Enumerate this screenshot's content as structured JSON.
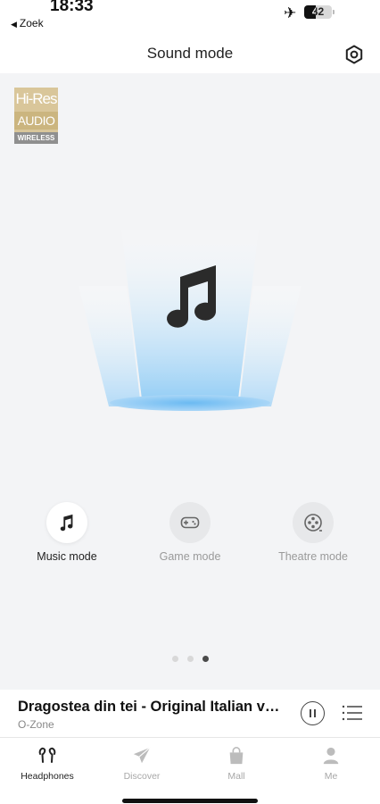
{
  "status_bar": {
    "time": "18:33",
    "back_label": "Zoek",
    "battery_level": "42",
    "battery_percent": 42
  },
  "header": {
    "title": "Sound mode",
    "settings_icon": "gear-hexagon-icon"
  },
  "badge": {
    "line1": "Hi-Res",
    "line2": "AUDIO",
    "line3": "WIRELESS"
  },
  "hero": {
    "icon": "music-note-icon",
    "colors": {
      "beam": "#bfe1fb",
      "glow": "#7dc4f4",
      "note": "#2b2b2b"
    }
  },
  "modes": [
    {
      "label": "Music mode",
      "icon": "music-note-icon",
      "active": true
    },
    {
      "label": "Game mode",
      "icon": "gamepad-icon",
      "active": false
    },
    {
      "label": "Theatre mode",
      "icon": "film-reel-icon",
      "active": false
    }
  ],
  "pager": {
    "count": 3,
    "active_index": 2
  },
  "player": {
    "title": "Dragostea din tei - Original Italian version",
    "artist": "O-Zone",
    "state": "playing"
  },
  "tabs": [
    {
      "label": "Headphones",
      "icon": "earbuds-icon",
      "active": true
    },
    {
      "label": "Discover",
      "icon": "paper-plane-icon",
      "active": false
    },
    {
      "label": "Mall",
      "icon": "shopping-bag-icon",
      "active": false
    },
    {
      "label": "Me",
      "icon": "person-icon",
      "active": false
    }
  ]
}
